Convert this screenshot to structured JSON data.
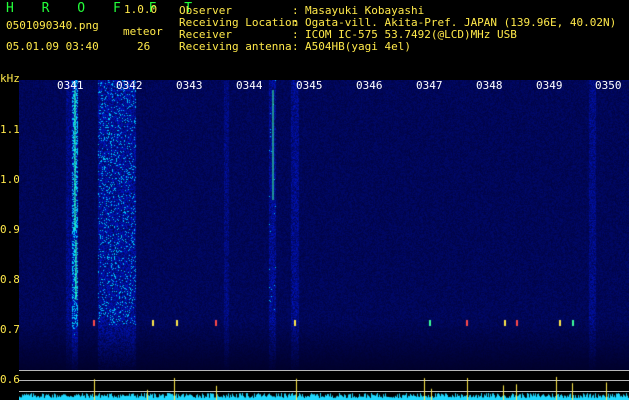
{
  "app": {
    "name": "H R O F F T",
    "version": "1.0.0"
  },
  "file": {
    "name": "0501090340.png",
    "datetime": "05.01.09 03:40"
  },
  "meteor": {
    "label": "meteor",
    "count": "26"
  },
  "info": [
    {
      "key": "Observer",
      "value": "Masayuki Kobayashi"
    },
    {
      "key": "Receiving Location",
      "value": "Ogata-vill. Akita-Pref. JAPAN (139.96E, 40.02N)"
    },
    {
      "key": "Receiver",
      "value": "ICOM IC-575 53.7492(@LCD)MHz USB"
    },
    {
      "key": "Receiving antenna",
      "value": "A504HB(yagi 4el)"
    }
  ],
  "separator": ":",
  "axis": {
    "y_unit": "kHz",
    "y_ticks": [
      "1.1",
      "1.0",
      "0.9",
      "0.8",
      "0.7",
      "0.6"
    ],
    "x_ticks": [
      "0341",
      "0342",
      "0343",
      "0344",
      "0345",
      "0346",
      "0347",
      "0348",
      "0349",
      "0350"
    ]
  },
  "colors": {
    "title": "#23ff3a",
    "text": "#ffe94a",
    "time_labels": "#ffffff",
    "background": "#000000"
  }
}
